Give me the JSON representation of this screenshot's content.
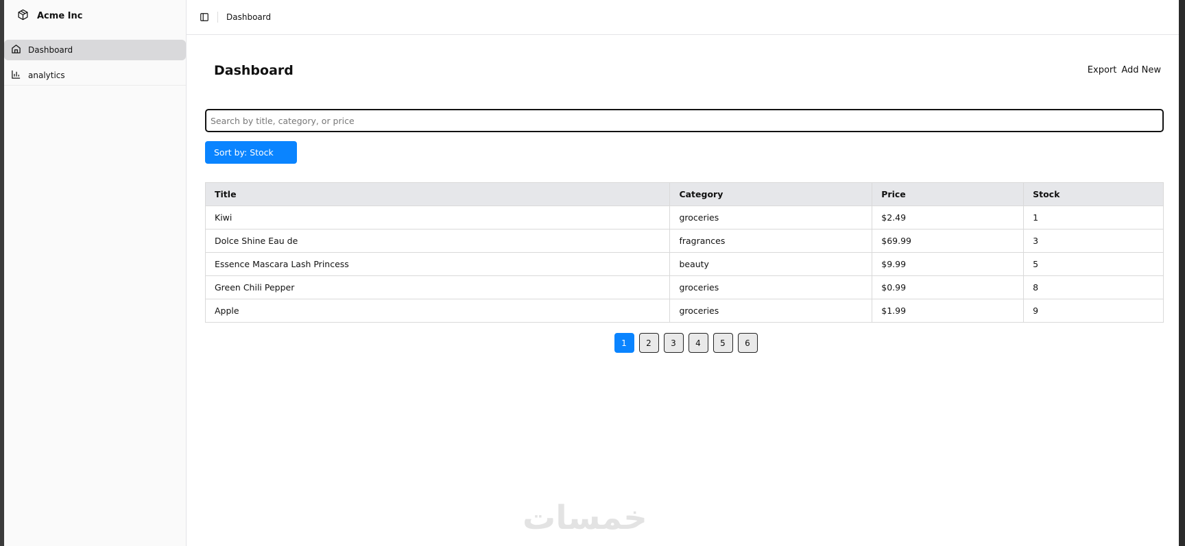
{
  "brand": {
    "name": "Acme Inc",
    "icon": "box-icon"
  },
  "sidebar": {
    "items": [
      {
        "label": "Dashboard",
        "icon": "home-icon",
        "active": true
      },
      {
        "label": "analytics",
        "icon": "bar-chart-icon",
        "active": false
      }
    ]
  },
  "topbar": {
    "breadcrumb": "Dashboard",
    "toggle_icon": "sidebar-toggle-icon"
  },
  "page": {
    "title": "Dashboard",
    "actions": {
      "export_label": "Export",
      "add_new_label": "Add New"
    }
  },
  "search": {
    "placeholder": "Search by title, category, or price",
    "value": ""
  },
  "sort": {
    "label": "Sort by: Stock"
  },
  "table": {
    "headers": [
      "Title",
      "Category",
      "Price",
      "Stock"
    ],
    "rows": [
      [
        "Kiwi",
        "groceries",
        "$2.49",
        "1"
      ],
      [
        "Dolce Shine Eau de",
        "fragrances",
        "$69.99",
        "3"
      ],
      [
        "Essence Mascara Lash Princess",
        "beauty",
        "$9.99",
        "5"
      ],
      [
        "Green Chili Pepper",
        "groceries",
        "$0.99",
        "8"
      ],
      [
        "Apple",
        "groceries",
        "$1.99",
        "9"
      ]
    ]
  },
  "pagination": {
    "pages": [
      "1",
      "2",
      "3",
      "4",
      "5",
      "6"
    ],
    "current": "1"
  },
  "watermark": {
    "text": "خمسات"
  },
  "colors": {
    "accent": "#0a84ff",
    "sidebar_bg": "#fafafa",
    "active_item_bg": "#d9d9db"
  }
}
